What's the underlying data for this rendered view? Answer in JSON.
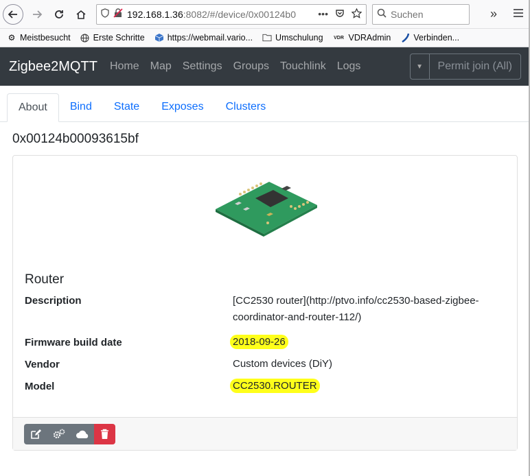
{
  "browser": {
    "url_host": "192.168.1.36",
    "url_rest": ":8082/#/device/0x00124b0",
    "search_placeholder": "Suchen"
  },
  "bookmarks": [
    {
      "label": "Meistbesucht",
      "icon": "gear-icon"
    },
    {
      "label": "Erste Schritte",
      "icon": "globe-icon"
    },
    {
      "label": "https://webmail.vario...",
      "icon": "cube-icon"
    },
    {
      "label": "Umschulung",
      "icon": "folder-icon"
    },
    {
      "label": "VDRAdmin",
      "icon": "vdr-logo-icon"
    },
    {
      "label": "Verbinden...",
      "icon": "swoosh-icon"
    }
  ],
  "navbar": {
    "brand": "Zigbee2MQTT",
    "links": [
      "Home",
      "Map",
      "Settings",
      "Groups",
      "Touchlink",
      "Logs"
    ],
    "permit_join": "Permit join (All)"
  },
  "tabs": [
    "About",
    "Bind",
    "State",
    "Exposes",
    "Clusters"
  ],
  "active_tab": "About",
  "device": {
    "id": "0x00124b00093615bf",
    "type": "Router",
    "properties": [
      {
        "key": "Description",
        "value": "[CC2530 router](http://ptvo.info/cc2530-based-zigbee-coordinator-and-router-112/)"
      },
      {
        "key": "Firmware build date",
        "value": "2018-09-26"
      },
      {
        "key": "Vendor",
        "value": "Custom devices (DiY)"
      },
      {
        "key": "Model",
        "value": "CC2530.ROUTER"
      }
    ]
  },
  "colors": {
    "navbar_bg": "#343a40",
    "link": "#0d6efd",
    "danger": "#dc3545",
    "highlight": "#ffff1a"
  }
}
